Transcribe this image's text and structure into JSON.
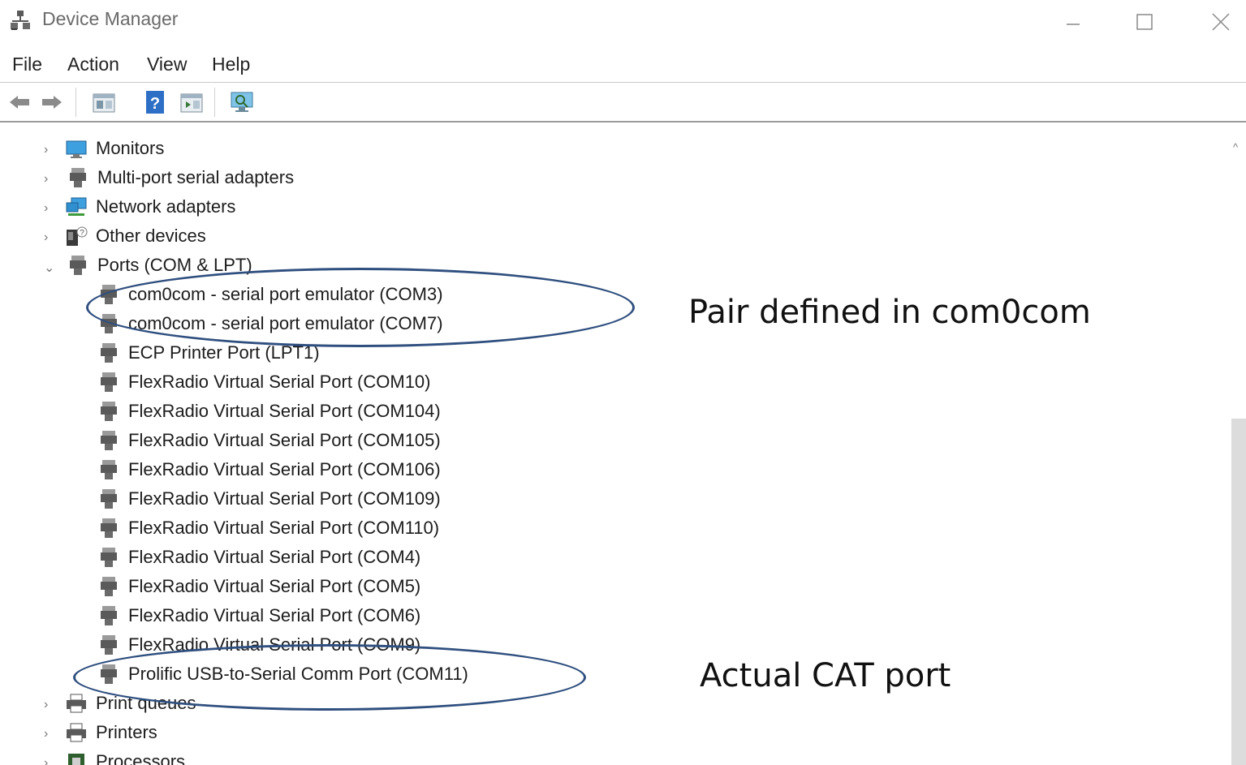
{
  "window": {
    "title": "Device Manager",
    "controls": {
      "minimize": "—",
      "maximize": "☐",
      "close": "✕"
    }
  },
  "menu": [
    "File",
    "Action",
    "View",
    "Help"
  ],
  "toolbar": {
    "buttons": [
      "back-icon",
      "forward-icon",
      "properties-icon",
      "help-icon",
      "update-driver-icon",
      "scan-hardware-icon"
    ]
  },
  "tree": {
    "categories_before": [
      {
        "label": "Monitors",
        "icon": "monitor-icon",
        "expanded": false
      },
      {
        "label": "Multi-port serial adapters",
        "icon": "port-connector-icon",
        "expanded": false
      },
      {
        "label": "Network adapters",
        "icon": "network-adapter-icon",
        "expanded": false
      },
      {
        "label": "Other devices",
        "icon": "unknown-device-icon",
        "expanded": false
      }
    ],
    "ports": {
      "label": "Ports (COM & LPT)",
      "icon": "port-connector-icon",
      "expanded": true,
      "children": [
        "com0com - serial port emulator (COM3)",
        "com0com - serial port emulator (COM7)",
        "ECP Printer Port (LPT1)",
        "FlexRadio Virtual Serial Port (COM10)",
        "FlexRadio Virtual Serial Port (COM104)",
        "FlexRadio Virtual Serial Port (COM105)",
        "FlexRadio Virtual Serial Port (COM106)",
        "FlexRadio Virtual Serial Port (COM109)",
        "FlexRadio Virtual Serial Port (COM110)",
        "FlexRadio Virtual Serial Port (COM4)",
        "FlexRadio Virtual Serial Port (COM5)",
        "FlexRadio Virtual Serial Port (COM6)",
        "FlexRadio Virtual Serial Port (COM9)",
        "Prolific USB-to-Serial Comm Port (COM11)"
      ]
    },
    "categories_after": [
      {
        "label": "Print queues",
        "icon": "printer-icon",
        "expanded": false
      },
      {
        "label": "Printers",
        "icon": "printer-icon",
        "expanded": false
      },
      {
        "label": "Processors",
        "icon": "processor-icon",
        "expanded": false
      }
    ]
  },
  "annotations": {
    "pair_label": "Pair defined in com0com",
    "cat_label": "Actual CAT port",
    "ellipse_color": "#2f4f7f"
  },
  "colors": {
    "title_text": "#6a6a6a",
    "row_text": "#1c1c1c"
  }
}
